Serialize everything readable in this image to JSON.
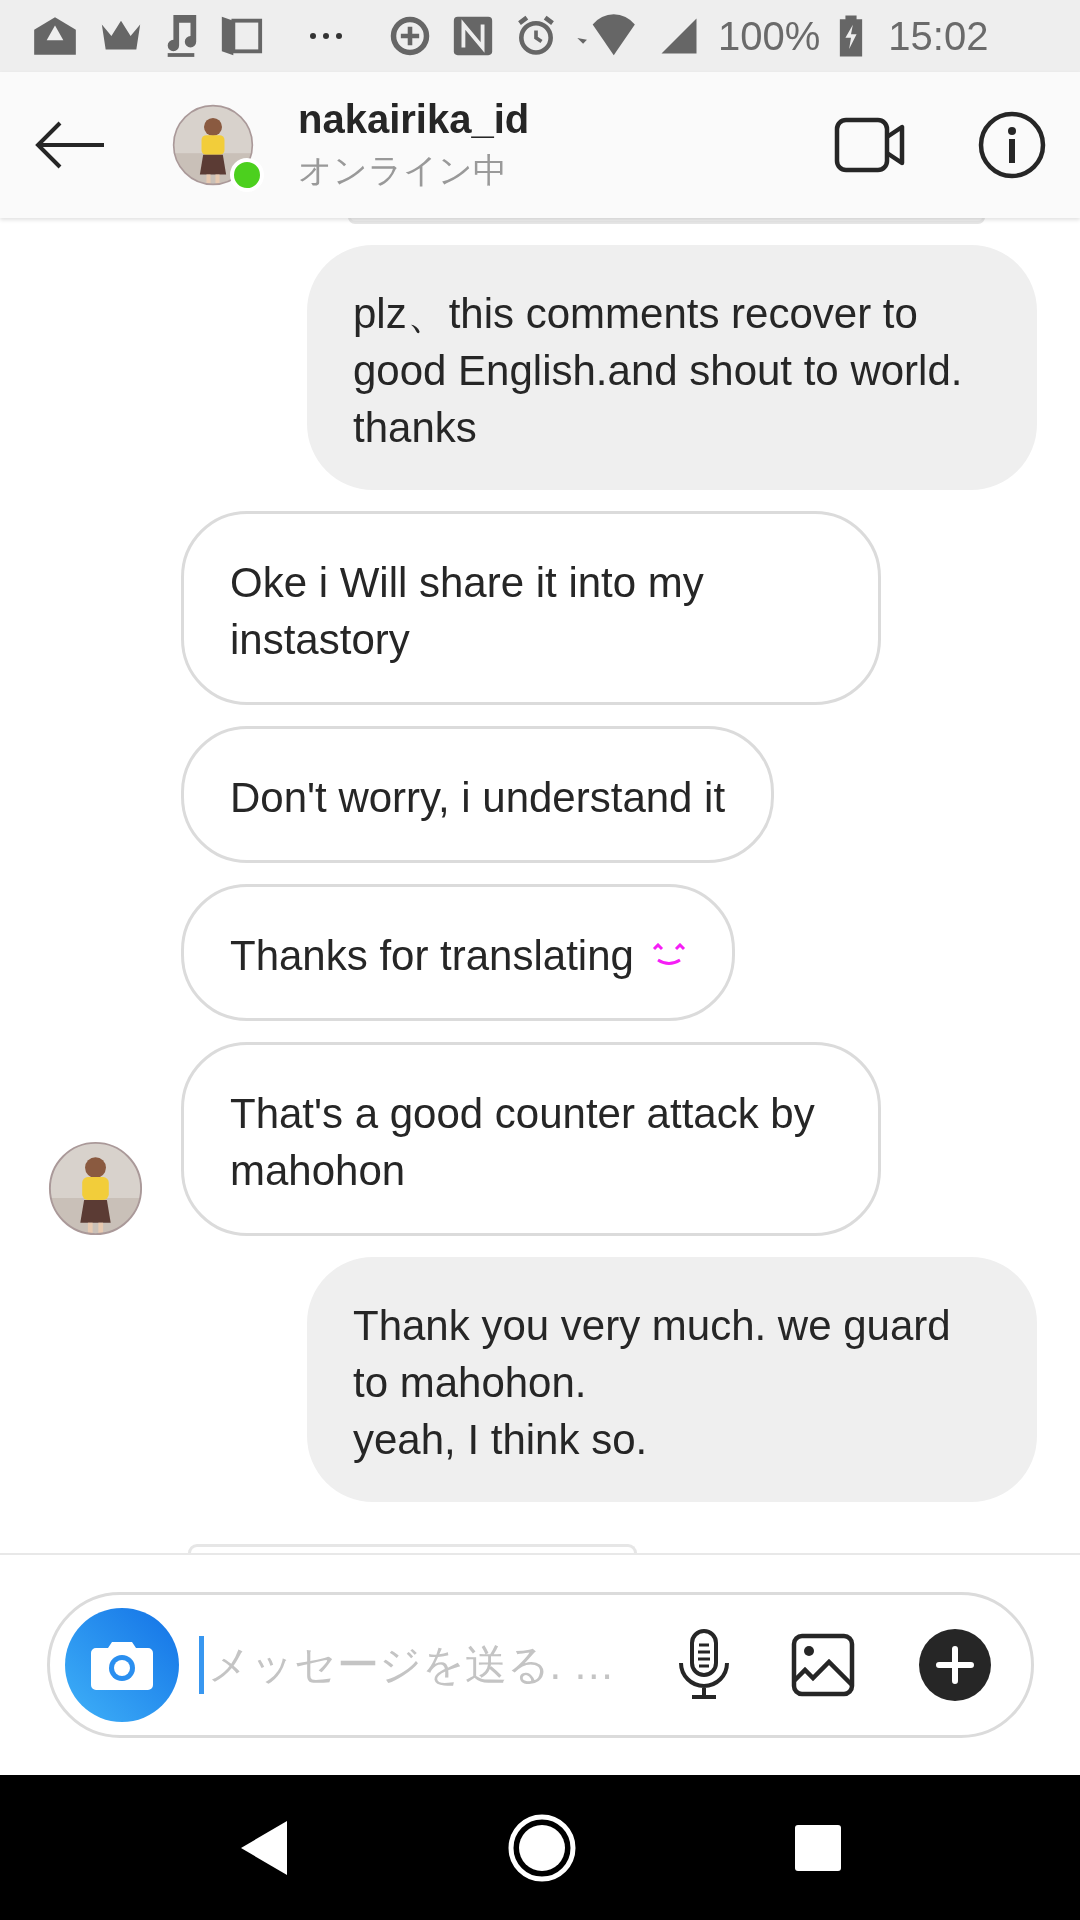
{
  "status_bar": {
    "battery": "100%",
    "time": "15:02"
  },
  "header": {
    "username": "nakairika_id",
    "status": "オンライン中",
    "online": true
  },
  "messages": [
    {
      "kind": "sent",
      "text": "plz、this comments recover to good English.and shout to world. thanks"
    },
    {
      "kind": "received",
      "text": "Oke i Will share it into my instastory"
    },
    {
      "kind": "received",
      "text": "Don't worry, i understand it"
    },
    {
      "kind": "received",
      "text": "Thanks for translating",
      "emoji": true
    },
    {
      "kind": "received",
      "text": "That's a good counter attack by mahohon",
      "avatar": true
    },
    {
      "kind": "sent",
      "text": "Thank you very much. we guard to mahohon.\nyeah, I think so."
    }
  ],
  "composer": {
    "placeholder": "メッセージを送る. …"
  }
}
